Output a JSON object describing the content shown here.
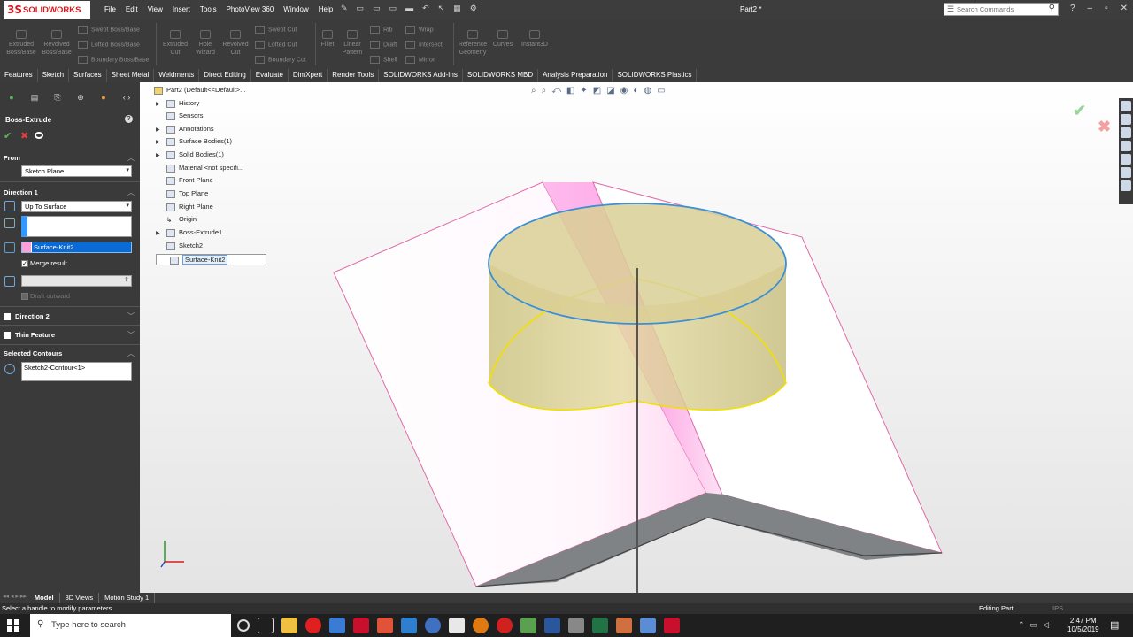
{
  "app": {
    "logo_mark": "3S",
    "logo_text": "SOLIDWORKS",
    "doc_title": "Part2 *"
  },
  "menu": [
    "File",
    "Edit",
    "View",
    "Insert",
    "Tools",
    "PhotoView 360",
    "Window",
    "Help"
  ],
  "search": {
    "placeholder": "Search Commands"
  },
  "ribbon": {
    "extruded_boss": "Extruded Boss/Base",
    "revolved_boss": "Revolved Boss/Base",
    "swept_boss": "Swept Boss/Base",
    "lofted_boss": "Lofted Boss/Base",
    "boundary_boss": "Boundary Boss/Base",
    "extruded_cut": "Extruded Cut",
    "hole_wizard": "Hole Wizard",
    "revolved_cut": "Revolved Cut",
    "swept_cut": "Swept Cut",
    "lofted_cut": "Lofted Cut",
    "boundary_cut": "Boundary Cut",
    "fillet": "Fillet",
    "linear_pattern": "Linear Pattern",
    "rib": "Rib",
    "draft": "Draft",
    "shell": "Shell",
    "wrap": "Wrap",
    "intersect": "Intersect",
    "mirror": "Mirror",
    "reference_geometry": "Reference Geometry",
    "curves": "Curves",
    "instant3d": "Instant3D"
  },
  "tabs": [
    "Features",
    "Sketch",
    "Surfaces",
    "Sheet Metal",
    "Weldments",
    "Direct Editing",
    "Evaluate",
    "DimXpert",
    "Render Tools",
    "SOLIDWORKS Add-Ins",
    "SOLIDWORKS MBD",
    "Analysis Preparation",
    "SOLIDWORKS Plastics"
  ],
  "pm": {
    "title": "Boss-Extrude",
    "help": "?",
    "from_label": "From",
    "from_value": "Sketch Plane",
    "direction1_label": "Direction 1",
    "direction1_value": "Up To Surface",
    "surface_value": "Surface-Knit2",
    "merge_label": "Merge result",
    "draft_label": "Draft outward",
    "direction2_label": "Direction 2",
    "thin_label": "Thin Feature",
    "contours_label": "Selected Contours",
    "contours_value": "Sketch2-Contour<1>"
  },
  "tree": {
    "root": "Part2  (Default<<Default>...",
    "items": [
      "History",
      "Sensors",
      "Annotations",
      "Surface Bodies(1)",
      "Solid Bodies(1)",
      "Material <not specifi...",
      "Front Plane",
      "Top Plane",
      "Right Plane",
      "Origin",
      "Boss-Extrude1",
      "Sketch2",
      "Surface-Knit2"
    ]
  },
  "bottom_tabs": [
    "Model",
    "3D Views",
    "Motion Study 1"
  ],
  "status": {
    "message": "Select a handle to modify parameters",
    "mode": "Editing Part",
    "units": "IPS"
  },
  "taskbar": {
    "search_placeholder": "Type here to search",
    "time": "2:47 PM",
    "date": "10/5/2019"
  },
  "colors": {
    "accent_blue": "#0a6ad6",
    "surface_pink": "#ff9ed8",
    "extrude_yellow": "#d8cc8a",
    "edge_blue": "#3b8fd6"
  },
  "icons": [
    "search-icon",
    "help-icon",
    "check-icon",
    "close-icon",
    "eye-icon",
    "windows-start-icon"
  ]
}
